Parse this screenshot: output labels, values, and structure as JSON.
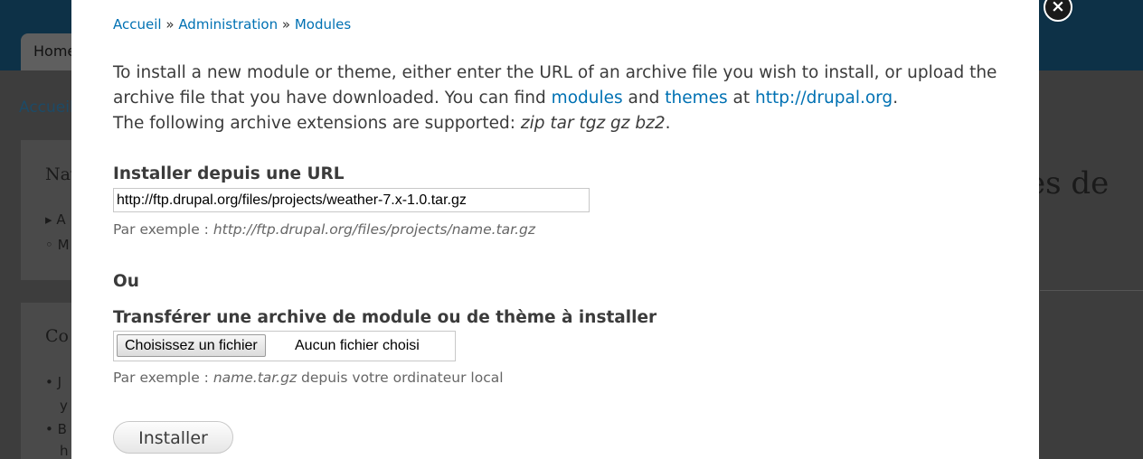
{
  "background": {
    "tab_label": "Home",
    "breadcrumb": "Accueil",
    "block1_title": "Nav",
    "block1_items": [
      "A",
      "M"
    ],
    "block2_title": "Co",
    "block2_items": [
      "J",
      "y",
      "B",
      "h"
    ],
    "right_title": "es de"
  },
  "modal": {
    "close_icon": "×",
    "breadcrumb": {
      "items": [
        "Accueil",
        "Administration",
        "Modules"
      ],
      "separator": "»"
    },
    "intro": {
      "part1": "To install a new module or theme, either enter the URL of an archive file you wish to install, or upload the archive file that you have downloaded. You can find ",
      "modules_link": "modules",
      "part2": " and ",
      "themes_link": "themes",
      "part3": " at ",
      "drupal_link": "http://drupal.org",
      "part4": ".",
      "line2": "The following archive extensions are supported: ",
      "extensions": "zip tar tgz gz bz2",
      "line2_end": "."
    },
    "url_section": {
      "label": "Installer depuis une URL",
      "value": "http://ftp.drupal.org/files/projects/weather-7.x-1.0.tar.gz",
      "desc_prefix": "Par exemple : ",
      "desc_example": "http://ftp.drupal.org/files/projects/name.tar.gz"
    },
    "or_label": "Ou",
    "upload_section": {
      "label": "Transférer une archive de module ou de thème à installer",
      "button_label": "Choisissez un fichier",
      "status": "Aucun fichier choisi",
      "desc_prefix": "Par exemple : ",
      "desc_example": "name.tar.gz",
      "desc_suffix": " depuis votre ordinateur local"
    },
    "submit_label": "Installer"
  }
}
